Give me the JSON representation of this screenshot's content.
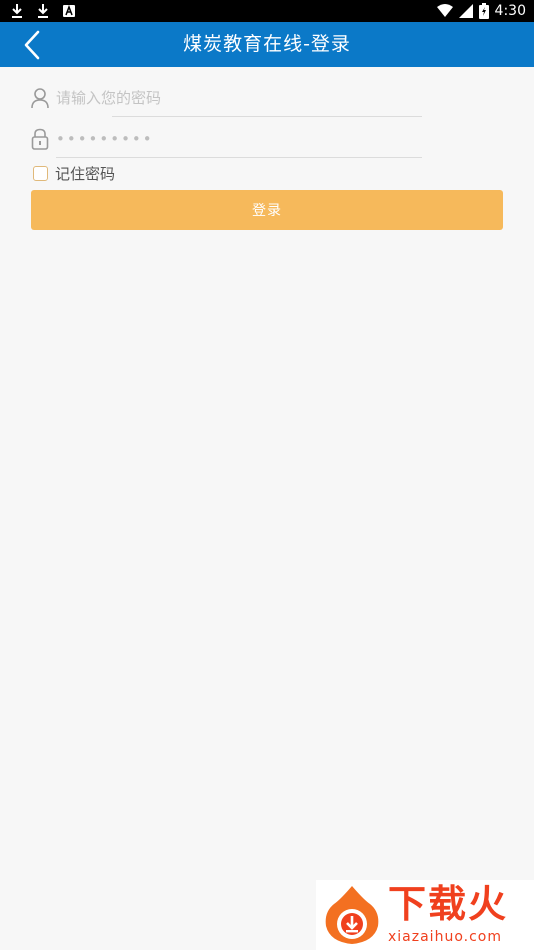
{
  "status_bar": {
    "time": "4:30",
    "left_icons": [
      "download-icon",
      "download-icon",
      "app-notification-icon"
    ],
    "right_icons": [
      "wifi-icon",
      "signal-icon",
      "battery-icon"
    ]
  },
  "header": {
    "title": "煤炭教育在线-登录",
    "back_icon": "chevron-left-icon",
    "background_color": "#0b79c8"
  },
  "form": {
    "username": {
      "icon": "user-icon",
      "value": "",
      "placeholder": "请输入您的密码"
    },
    "password": {
      "icon": "lock-icon",
      "value": "",
      "placeholder": "•••••••••"
    },
    "remember": {
      "label": "记住密码",
      "checked": false
    },
    "login_button": {
      "label": "登录",
      "color": "#f6b95b"
    }
  },
  "watermark": {
    "title": "下载火",
    "url": "xiazaihuo.com",
    "color": "#f0401e"
  }
}
